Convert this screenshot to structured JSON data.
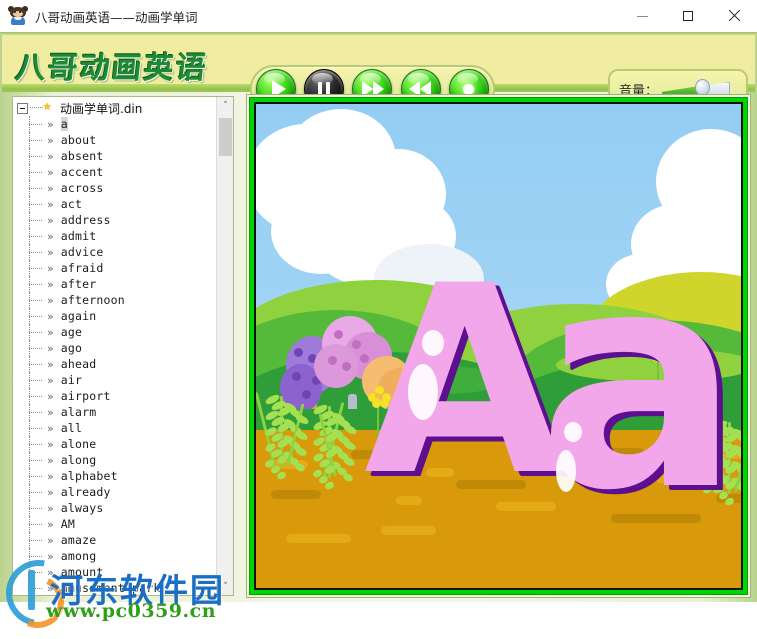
{
  "window": {
    "title": "八哥动画英语——动画学单词",
    "icon": "mynah-bird-icon",
    "controls": {
      "minimize": "minimize-button",
      "maximize": "maximize-button",
      "close": "close-button"
    }
  },
  "banner": {
    "logo_text": "八哥动画英语",
    "accent_color": "#1e8a32",
    "background_start": "#f2e98a",
    "background_end": "#cbe383"
  },
  "transport": {
    "buttons": [
      {
        "name": "play-button",
        "icon": "play-icon",
        "label": "播放"
      },
      {
        "name": "pause-button",
        "icon": "pause-icon",
        "label": "暂停"
      },
      {
        "name": "next-button",
        "icon": "fast-forward-icon",
        "label": "下一个"
      },
      {
        "name": "prev-button",
        "icon": "rewind-icon",
        "label": "上一个"
      },
      {
        "name": "stop-button",
        "icon": "stop-record-icon",
        "label": "停止"
      }
    ]
  },
  "volume": {
    "label": "音量：",
    "value": 55,
    "fill_color": "#2f9a12"
  },
  "tree": {
    "root": {
      "label": "动画学单词.din",
      "icon": "star-icon",
      "expanded": true
    },
    "items": [
      "a",
      "about",
      "absent",
      "accent",
      "across",
      "act",
      "address",
      "admit",
      "advice",
      "afraid",
      "after",
      "afternoon",
      "again",
      "age",
      "ago",
      "ahead",
      "air",
      "airport",
      "alarm",
      "all",
      "alone",
      "along",
      "alphabet",
      "already",
      "always",
      "AM",
      "amaze",
      "among",
      "amount",
      "amusement park"
    ],
    "selected_index": 0,
    "scrollbar": {
      "up_arrow": "˄",
      "down_arrow": "˅"
    }
  },
  "animation": {
    "frame_color": "#00d400",
    "letters": [
      {
        "char": "A",
        "case": "uppercase"
      },
      {
        "char": "a",
        "case": "lowercase"
      }
    ],
    "scene": "sunny-hills-with-trees-and-flowers",
    "sky_color": "#a5d6f6",
    "ground_color": "#d89a0a",
    "letter_color": "#f2a7ea",
    "letter_shadow_color": "#5c0f8f"
  },
  "watermark": {
    "site_name": "河东软件园",
    "url": "www.pc0359.cn"
  }
}
